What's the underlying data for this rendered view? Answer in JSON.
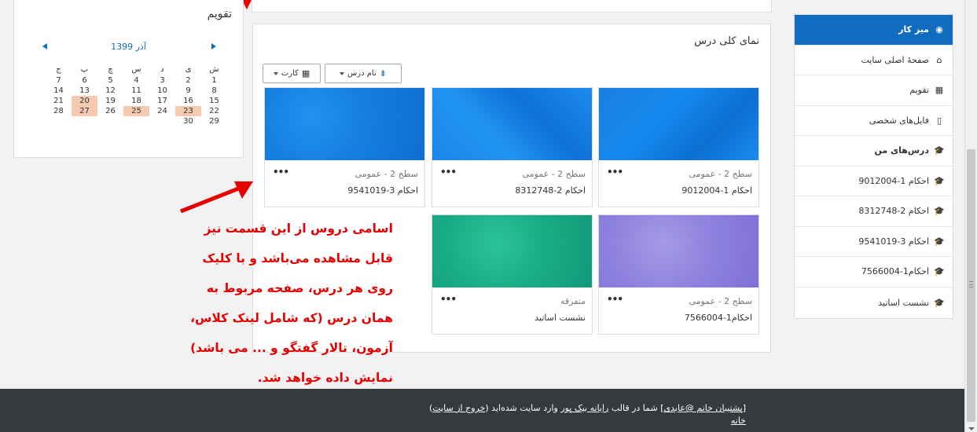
{
  "calendar": {
    "title": "تقویم",
    "month": "آذر 1399",
    "weekdays": [
      "ش",
      "ی",
      "د",
      "س",
      "چ",
      "پ",
      "ج"
    ],
    "weeks": [
      [
        "1",
        "2",
        "3",
        "4",
        "5",
        "6",
        "7"
      ],
      [
        "8",
        "9",
        "10",
        "11",
        "12",
        "13",
        "14"
      ],
      [
        "15",
        "16",
        "17",
        "18",
        "19",
        "20",
        "21"
      ],
      [
        "22",
        "23",
        "24",
        "25",
        "26",
        "27",
        "28"
      ],
      [
        "29",
        "30",
        "",
        "",
        "",
        "",
        ""
      ]
    ],
    "highlighted_days": [
      "20",
      "23",
      "25",
      "27"
    ]
  },
  "course_overview": {
    "title": "نمای کلی درس",
    "sort_label": "نام درس",
    "view_label": "کارت",
    "courses": [
      {
        "category": "سطح 2 - عمومی",
        "name": "احکام 1-9012004",
        "bg": "blue1"
      },
      {
        "category": "سطح 2 - عمومی",
        "name": "احکام 2-8312748",
        "bg": "blue2"
      },
      {
        "category": "سطح 2 - عمومی",
        "name": "احکام 3-9541019",
        "bg": "blue3"
      },
      {
        "category": "سطح 2 - عمومی",
        "name": "احکام1-7566004",
        "bg": "purple"
      },
      {
        "category": "متفرقه",
        "name": "نشست اساتید",
        "bg": "green"
      }
    ],
    "menu_glyph": "•••"
  },
  "nav": {
    "items": [
      {
        "label": "میز کار",
        "icon": "dashboard-icon",
        "glyph": "◉"
      },
      {
        "label": "صفحهٔ اصلی سایت",
        "icon": "home-icon",
        "glyph": "⌂"
      },
      {
        "label": "تقویم",
        "icon": "calendar-icon",
        "glyph": "▦"
      },
      {
        "label": "فایل‌های شخصی",
        "icon": "file-icon",
        "glyph": "▯"
      },
      {
        "label": "درس‌های من",
        "icon": "graduation-cap-icon",
        "glyph": "🎓"
      },
      {
        "label": "احکام 1-9012004",
        "icon": "graduation-cap-icon",
        "glyph": "🎓"
      },
      {
        "label": "احکام 2-8312748",
        "icon": "graduation-cap-icon",
        "glyph": "🎓"
      },
      {
        "label": "احکام 3-9541019",
        "icon": "graduation-cap-icon",
        "glyph": "🎓"
      },
      {
        "label": "احکام1-7566004",
        "icon": "graduation-cap-icon",
        "glyph": "🎓"
      },
      {
        "label": "نشست اساتید",
        "icon": "graduation-cap-icon",
        "glyph": "🎓"
      }
    ]
  },
  "annotation": {
    "text": "اسامی دروس از این قسمت نیز قابل مشاهده می‌باشد و با کلیک روی هر درس، صفحه مربوط به همان درس (که شامل لینک کلاس، آزمون، تالار گفتگو و ... می باشد) نمایش داده خواهد شد."
  },
  "footer": {
    "login_user": "پشتیبان خانم @عابدی",
    "bracket_open": "[",
    "bracket_close": "]",
    "mid_text": "شما در قالب",
    "theme_link": "رایانه بیک پور",
    "tail_text": "وارد سایت شده‌اید",
    "logout_link": "خروج از سایت",
    "home_link": "خانه"
  },
  "colors": {
    "accent": "#0f6cbf",
    "annotation": "#e60000",
    "footer_bg": "#373a3c",
    "highlight_day": "#f6c9b1"
  }
}
